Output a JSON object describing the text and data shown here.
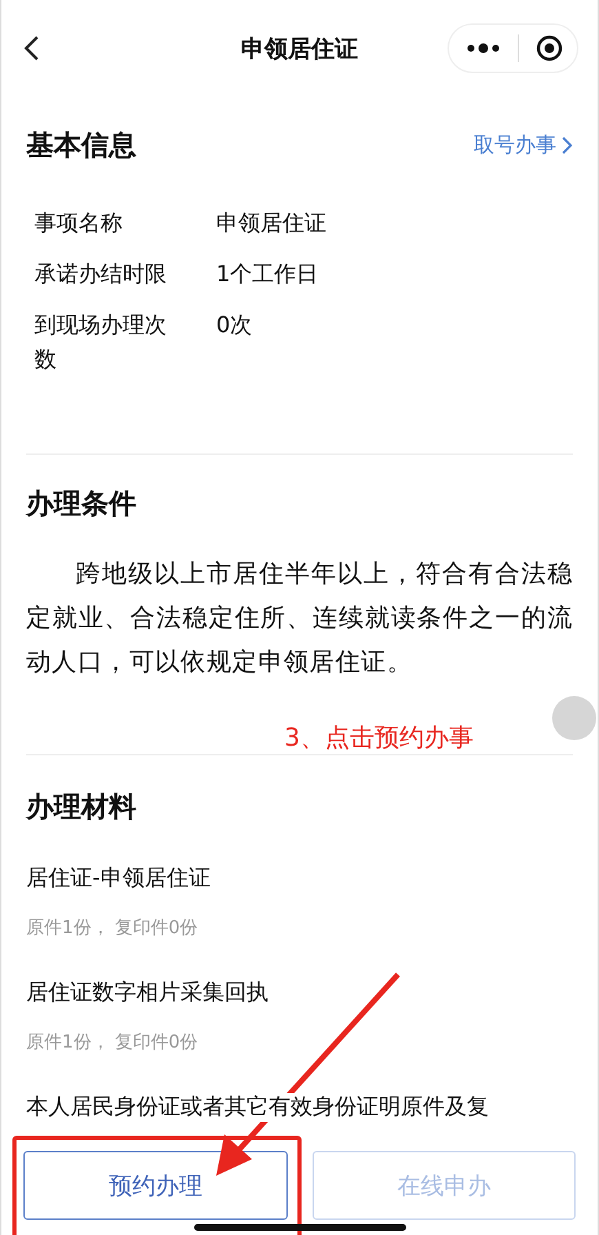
{
  "nav": {
    "title": "申领居住证"
  },
  "basic": {
    "title": "基本信息",
    "link": "取号办事",
    "rows": [
      {
        "label": "事项名称",
        "value": "申领居住证"
      },
      {
        "label": "承诺办结时限",
        "value": "1个工作日"
      },
      {
        "label": "到现场办理次数",
        "value": "0次"
      }
    ]
  },
  "conditions": {
    "title": "办理条件",
    "text": "跨地级以上市居住半年以上，符合有合法稳定就业、合法稳定住所、连续就读条件之一的流动人口，可以依规定申领居住证。"
  },
  "annotation": {
    "text": "3、点击预约办事"
  },
  "materials": {
    "title": "办理材料",
    "items": [
      {
        "name": "居住证-申领居住证",
        "detail": "原件1份，  复印件0份"
      },
      {
        "name": "居住证数字相片采集回执",
        "detail": "原件1份，  复印件0份"
      },
      {
        "name": "本人居民身份证或者其它有效身份证明原件及复"
      }
    ]
  },
  "buttons": [
    {
      "label": "预约办理",
      "disabled": false
    },
    {
      "label": "在线申办",
      "disabled": true
    }
  ]
}
